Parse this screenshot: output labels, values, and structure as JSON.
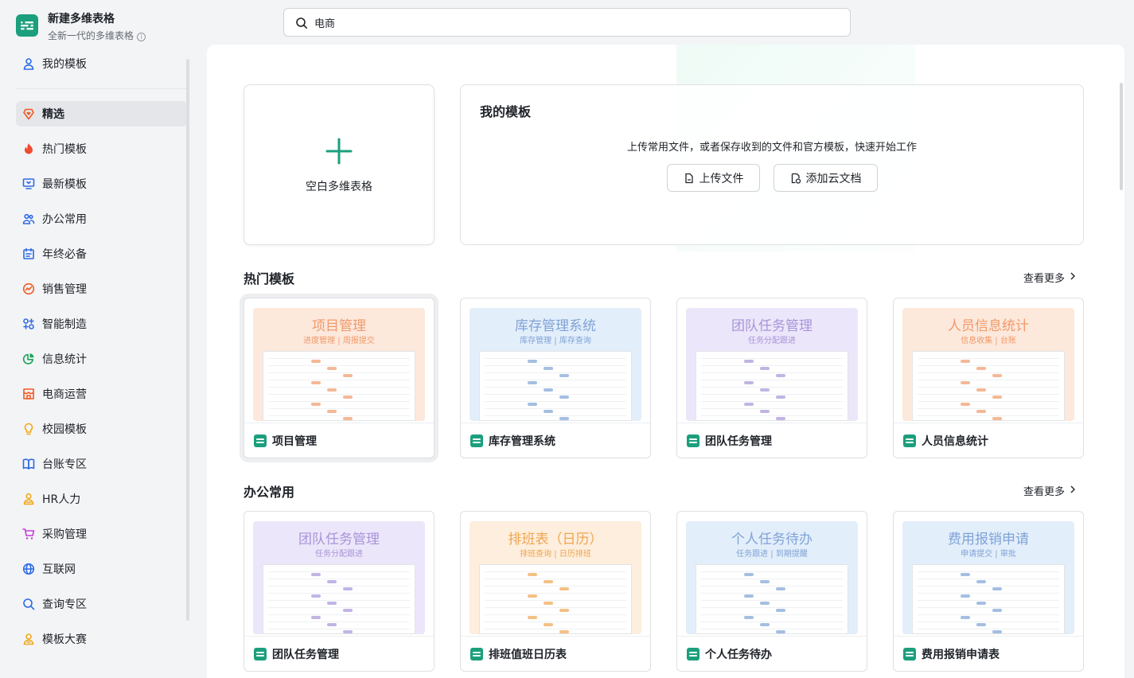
{
  "app": {
    "title": "新建多维表格",
    "subtitle": "全新一代的多维表格",
    "info_glyph": "i",
    "accent": "#1b9f7c"
  },
  "search": {
    "value": "电商",
    "icon": "search-icon"
  },
  "sidebar": {
    "my_templates": "我的模板",
    "items": [
      {
        "label": "精选",
        "icon": "heart-shield-icon",
        "color": "#f05a24",
        "active": true
      },
      {
        "label": "热门模板",
        "icon": "flame-icon",
        "color": "#f04a2f"
      },
      {
        "label": "最新模板",
        "icon": "monitor-icon",
        "color": "#2e6be6"
      },
      {
        "label": "办公常用",
        "icon": "people-icon",
        "color": "#2e6be6"
      },
      {
        "label": "年终必备",
        "icon": "calendar-icon",
        "color": "#2e6be6"
      },
      {
        "label": "销售管理",
        "icon": "chart-circle-icon",
        "color": "#f05a24"
      },
      {
        "label": "智能制造",
        "icon": "gear-cross-icon",
        "color": "#2e6be6"
      },
      {
        "label": "信息统计",
        "icon": "pie-icon",
        "color": "#1aa35a"
      },
      {
        "label": "电商运营",
        "icon": "shop-icon",
        "color": "#f05a24"
      },
      {
        "label": "校园模板",
        "icon": "bulb-icon",
        "color": "#f0a81a"
      },
      {
        "label": "台账专区",
        "icon": "book-icon",
        "color": "#2e6be6"
      },
      {
        "label": "HR人力",
        "icon": "person-icon",
        "color": "#f0a81a"
      },
      {
        "label": "采购管理",
        "icon": "cart-icon",
        "color": "#c43dd8"
      },
      {
        "label": "互联网",
        "icon": "globe-icon",
        "color": "#2e6be6"
      },
      {
        "label": "查询专区",
        "icon": "magnifier-icon",
        "color": "#2e6be6"
      },
      {
        "label": "模板大赛",
        "icon": "trophy-person-icon",
        "color": "#f0a81a"
      }
    ]
  },
  "main": {
    "blank_card_label": "空白多维表格",
    "my_panel": {
      "title": "我的模板",
      "desc": "上传常用文件，或者保存收到的文件和官方模板，快速开始工作",
      "upload_label": "上传文件",
      "add_cloud_label": "添加云文档"
    },
    "sections": [
      {
        "title": "热门模板",
        "see_more": "查看更多",
        "cards": [
          {
            "name": "项目管理",
            "preview_title": "项目管理",
            "preview_sub": "进度管理 | 周报提交",
            "bg": "#fde8dc",
            "title_color": "#f09a6a"
          },
          {
            "name": "库存管理系统",
            "preview_title": "库存管理系统",
            "preview_sub": "库存管理 | 库存查询",
            "bg": "#e3eefb",
            "title_color": "#7fa3d6"
          },
          {
            "name": "团队任务管理",
            "preview_title": "团队任务管理",
            "preview_sub": "任务分配跟进",
            "bg": "#ece6fa",
            "title_color": "#a794d8"
          },
          {
            "name": "人员信息统计",
            "preview_title": "人员信息统计",
            "preview_sub": "信息收集 | 台账",
            "bg": "#fde8dc",
            "title_color": "#f09a6a"
          }
        ]
      },
      {
        "title": "办公常用",
        "see_more": "查看更多",
        "cards": [
          {
            "name": "团队任务管理",
            "preview_title": "团队任务管理",
            "preview_sub": "任务分配跟进",
            "bg": "#ece6fa",
            "title_color": "#a794d8"
          },
          {
            "name": "排班值班日历表",
            "preview_title": "排班表（日历）",
            "preview_sub": "排班查询 | 日历排班",
            "bg": "#fdeedd",
            "title_color": "#f0a550"
          },
          {
            "name": "个人任务待办",
            "preview_title": "个人任务待办",
            "preview_sub": "任务跟进 | 到期提醒",
            "bg": "#e3eefb",
            "title_color": "#7fa3d6"
          },
          {
            "name": "费用报销申请表",
            "preview_title": "费用报销申请",
            "preview_sub": "申请提交 | 审批",
            "bg": "#e3eefb",
            "title_color": "#7fa3d6"
          }
        ]
      }
    ]
  }
}
